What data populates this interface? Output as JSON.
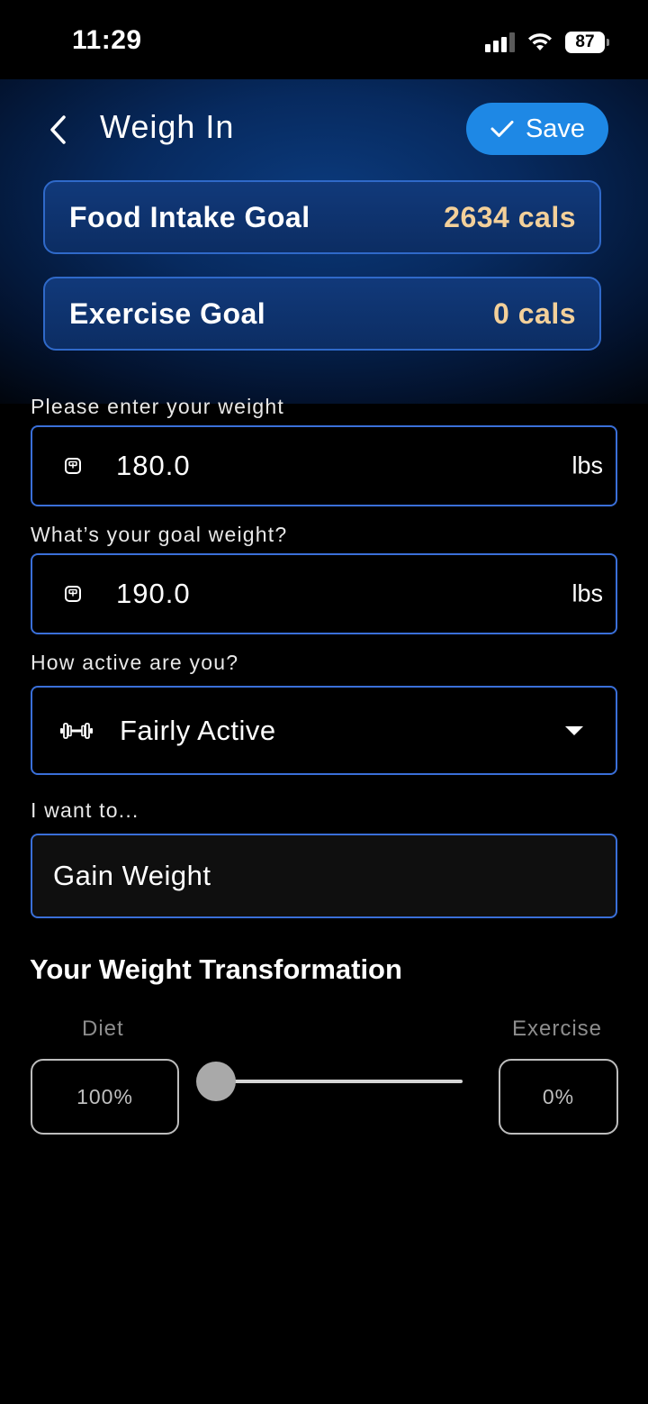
{
  "status_bar": {
    "time": "11:29",
    "battery": "87",
    "icons": [
      "signal-icon",
      "wifi-icon",
      "battery-icon"
    ]
  },
  "header": {
    "title": "Weigh In",
    "back_icon": "chevron-left-icon",
    "save_label": "Save",
    "save_icon": "checkmark-icon"
  },
  "goals": [
    {
      "label": "Food Intake Goal",
      "value": "2634 cals"
    },
    {
      "label": "Exercise Goal",
      "value": "0 cals"
    }
  ],
  "form": {
    "current_weight": {
      "label": "Please enter your weight",
      "value": "180.0",
      "unit": "lbs",
      "icon": "scale-icon"
    },
    "goal_weight": {
      "label": "What’s your goal weight?",
      "value": "190.0",
      "unit": "lbs",
      "icon": "scale-icon"
    },
    "activity": {
      "label": "How active are you?",
      "value": "Fairly Active",
      "icon": "dumbbell-icon"
    },
    "goal": {
      "label": "I want to...",
      "value": "Gain Weight"
    }
  },
  "transformation": {
    "title": "Your Weight Transformation",
    "diet_label": "Diet",
    "exercise_label": "Exercise",
    "diet_value": "100%",
    "exercise_value": "0%",
    "slider_exercise_fraction": 0
  },
  "colors": {
    "accent": "#1e88e5",
    "goal_value": "#f3d09a",
    "field_border": "#3a6fd8"
  }
}
